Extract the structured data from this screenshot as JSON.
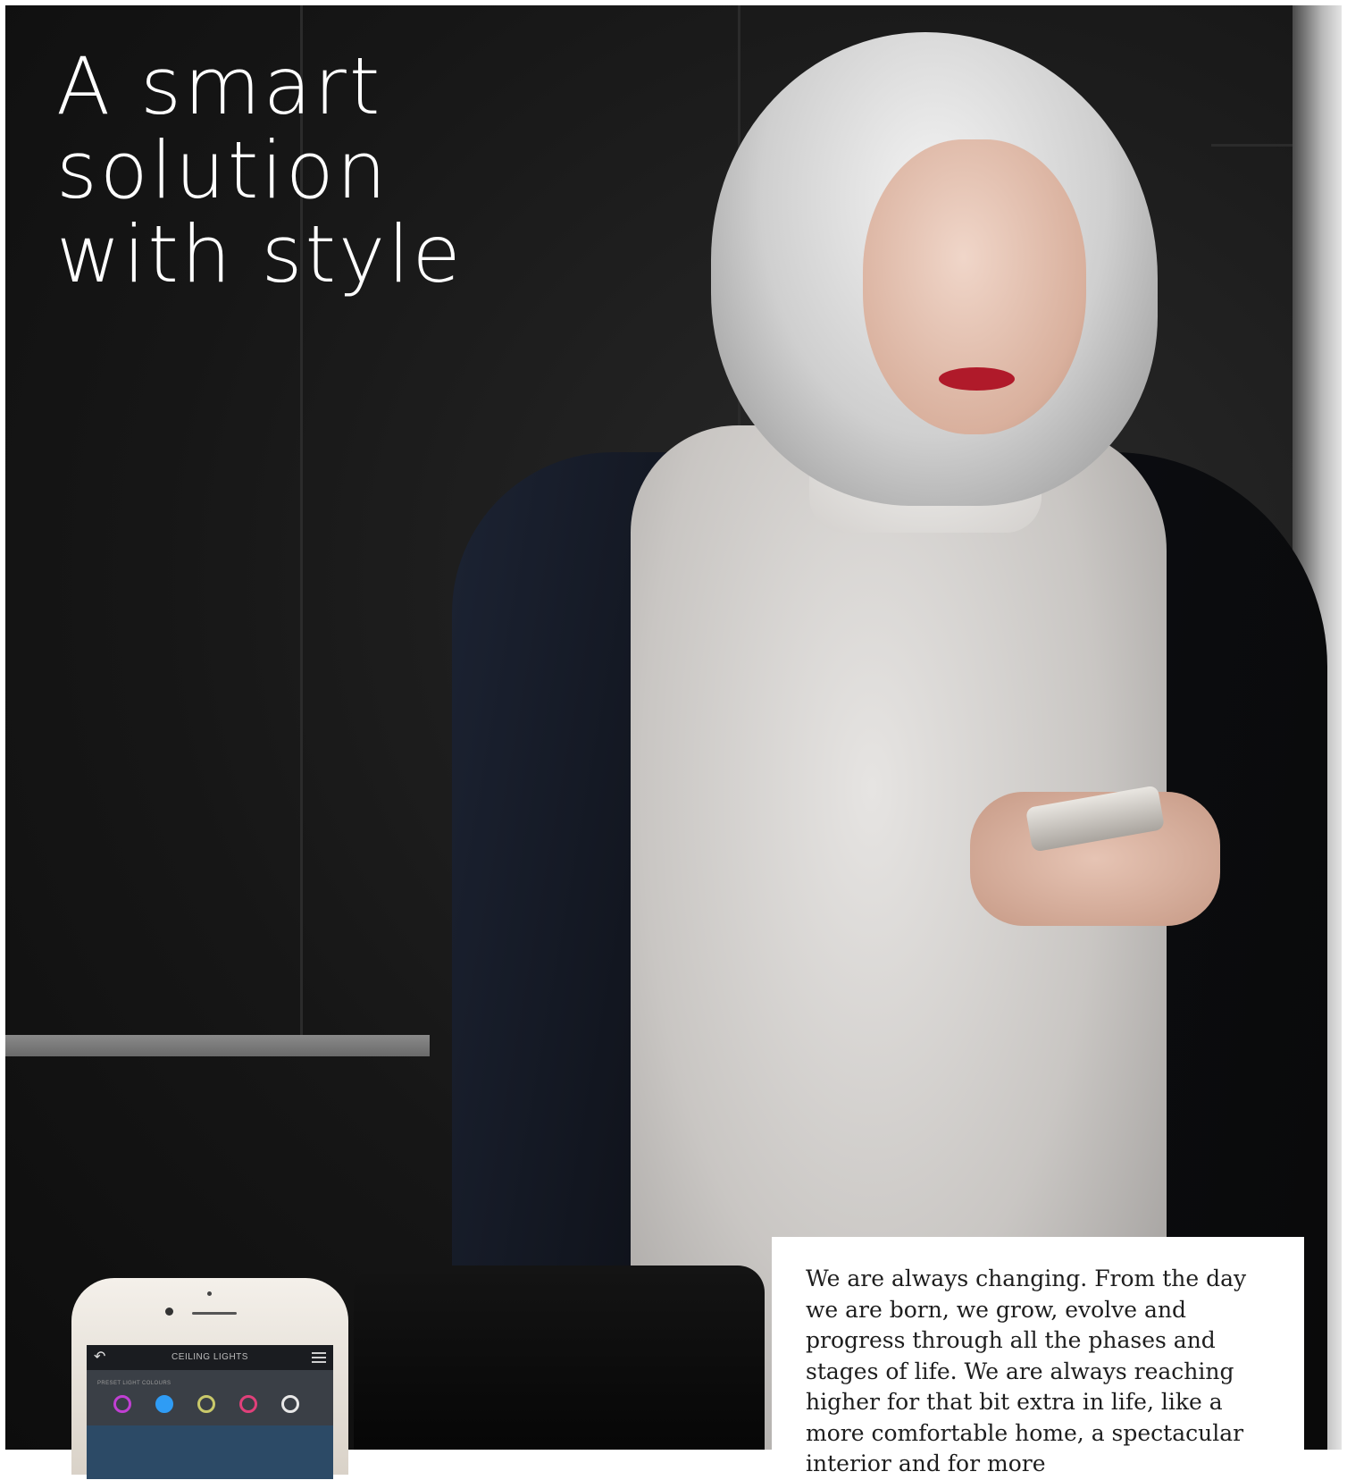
{
  "headline": {
    "line1": "A smart",
    "line2": "solution",
    "line3": "with style"
  },
  "phone_app": {
    "back_icon": "back-arrow-icon",
    "title": "CEILING LIGHTS",
    "menu_icon": "hamburger-menu-icon",
    "section_label": "PRESET LIGHT COLOURS",
    "swatches": [
      {
        "name": "magenta",
        "color": "#c13fd3",
        "filled": false
      },
      {
        "name": "blue",
        "color": "#2f9cf5",
        "filled": true
      },
      {
        "name": "yellow",
        "color": "#c9c96a",
        "filled": false
      },
      {
        "name": "pink",
        "color": "#e0407a",
        "filled": false
      },
      {
        "name": "white",
        "color": "#e8e8e8",
        "filled": false
      }
    ]
  },
  "body_text": "We are always changing. From the day we are born, we grow, evolve and progress through all the phases and stages of life. We are always reaching higher for that bit extra in life, like a more comfortable home, a spectacular interior and for more"
}
